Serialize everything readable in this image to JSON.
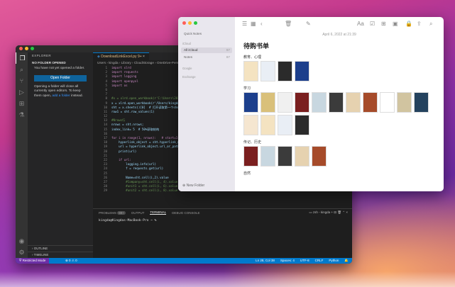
{
  "vscode": {
    "window_title": "Downl",
    "explorer_label": "EXPLORER",
    "no_folder_label": "NO FOLDER OPENED",
    "no_folder_msg": "You have not yet opened a folder.",
    "open_folder_btn": "Open Folder",
    "info_msg_1": "Opening a folder will close all currently open editors. To keep them open, ",
    "info_link": "add a folder",
    "info_msg_2": " instead.",
    "outline_label": "OUTLINE",
    "timeline_label": "TIMELINE",
    "tab_name": "DownloadLinkExcel.py",
    "tab_badge": "9+",
    "breadcrumb": "Users › kingda › Library › CloudStorage › OneDrive-Pers",
    "code_lines": [
      {
        "n": "1",
        "text": "import xlrd"
      },
      {
        "n": "2",
        "text": "import requests"
      },
      {
        "n": "3",
        "text": "import logging"
      },
      {
        "n": "4",
        "text": "import openpyxl"
      },
      {
        "n": "5",
        "text": "import os"
      },
      {
        "n": "6",
        "text": ""
      },
      {
        "n": "7",
        "text": ""
      },
      {
        "n": "8",
        "text": "#x = xlrd.open_workbook(r'C:\\Users\\2011\\Dow"
      },
      {
        "n": "9",
        "text": "x = xlrd.open_workbook(r'/Users/kingda/Dow"
      },
      {
        "n": "10",
        "text": "sht = x.sheets()[0]  # 打开读取第一个sheet"
      },
      {
        "n": "11",
        "text": "row1 = sht.row_values(1)"
      },
      {
        "n": "12",
        "text": ""
      },
      {
        "n": "13",
        "text": "#Nrows行"
      },
      {
        "n": "14",
        "text": "nrows = sht.nrows;"
      },
      {
        "n": "15",
        "text": "index_link= 5  # 50%获取结构"
      },
      {
        "n": "16",
        "text": ""
      },
      {
        "n": "17",
        "text": "for i in range(1, nrows):   # start=1 表示"
      },
      {
        "n": "18",
        "text": "    hyperlink_object = sht.hyperlink_map.g"
      },
      {
        "n": "19",
        "text": "    url = hyperlink_object.url_or_path"
      },
      {
        "n": "20",
        "text": "    print(url)"
      },
      {
        "n": "21",
        "text": ""
      },
      {
        "n": "22",
        "text": "    if url:"
      },
      {
        "n": "23",
        "text": "        logging.info(url)"
      },
      {
        "n": "24",
        "text": "        f = requests.get(url)"
      },
      {
        "n": "25",
        "text": ""
      },
      {
        "n": "26",
        "text": "        Name=sht.cell(i,2).value"
      },
      {
        "n": "27",
        "text": "        #Company=sht.cell(i, 4).value"
      },
      {
        "n": "28",
        "text": "        #unit1 = sht.cell(i, 6).value"
      },
      {
        "n": "29",
        "text": "        #unit2 = sht.cell(i, 8).value"
      }
    ],
    "panel_tabs": [
      "PROBLEMS",
      "OUTPUT",
      "TERMINAL",
      "DEBUG CONSOLE"
    ],
    "problems_badge": "99+",
    "terminal_label": "zsh - kingda",
    "terminal_line": "kingda@Kingdas-MacBook-Pro ~ %",
    "status_left": "Restricted Mode",
    "status_warnings": "0",
    "status_errors": "0",
    "status_right": [
      "Ln 28, Col 38",
      "Spaces: 4",
      "UTF-8",
      "CRLF",
      "Python"
    ]
  },
  "notes": {
    "sidebar": {
      "quick_notes": "Quick Notes",
      "icloud_group": "iCloud",
      "all_icloud": "All iCloud",
      "all_icloud_count": "67",
      "notes_label": "Notes",
      "notes_count": "67",
      "google_group": "Google",
      "exchange_group": "Exchange",
      "new_folder": "New Folder"
    },
    "date": "April 6, 2022 at 21:39",
    "title": "待购书单",
    "sections": [
      {
        "label": "教育、心理",
        "count": 4
      },
      {
        "label": "学习",
        "count": 15
      },
      {
        "label": "传记、历史",
        "count": 5
      },
      {
        "label": "自然",
        "count": 0
      }
    ],
    "colors": {
      "sidebar_bg": "#e9e7ee",
      "selection": "#d9d6df"
    }
  }
}
